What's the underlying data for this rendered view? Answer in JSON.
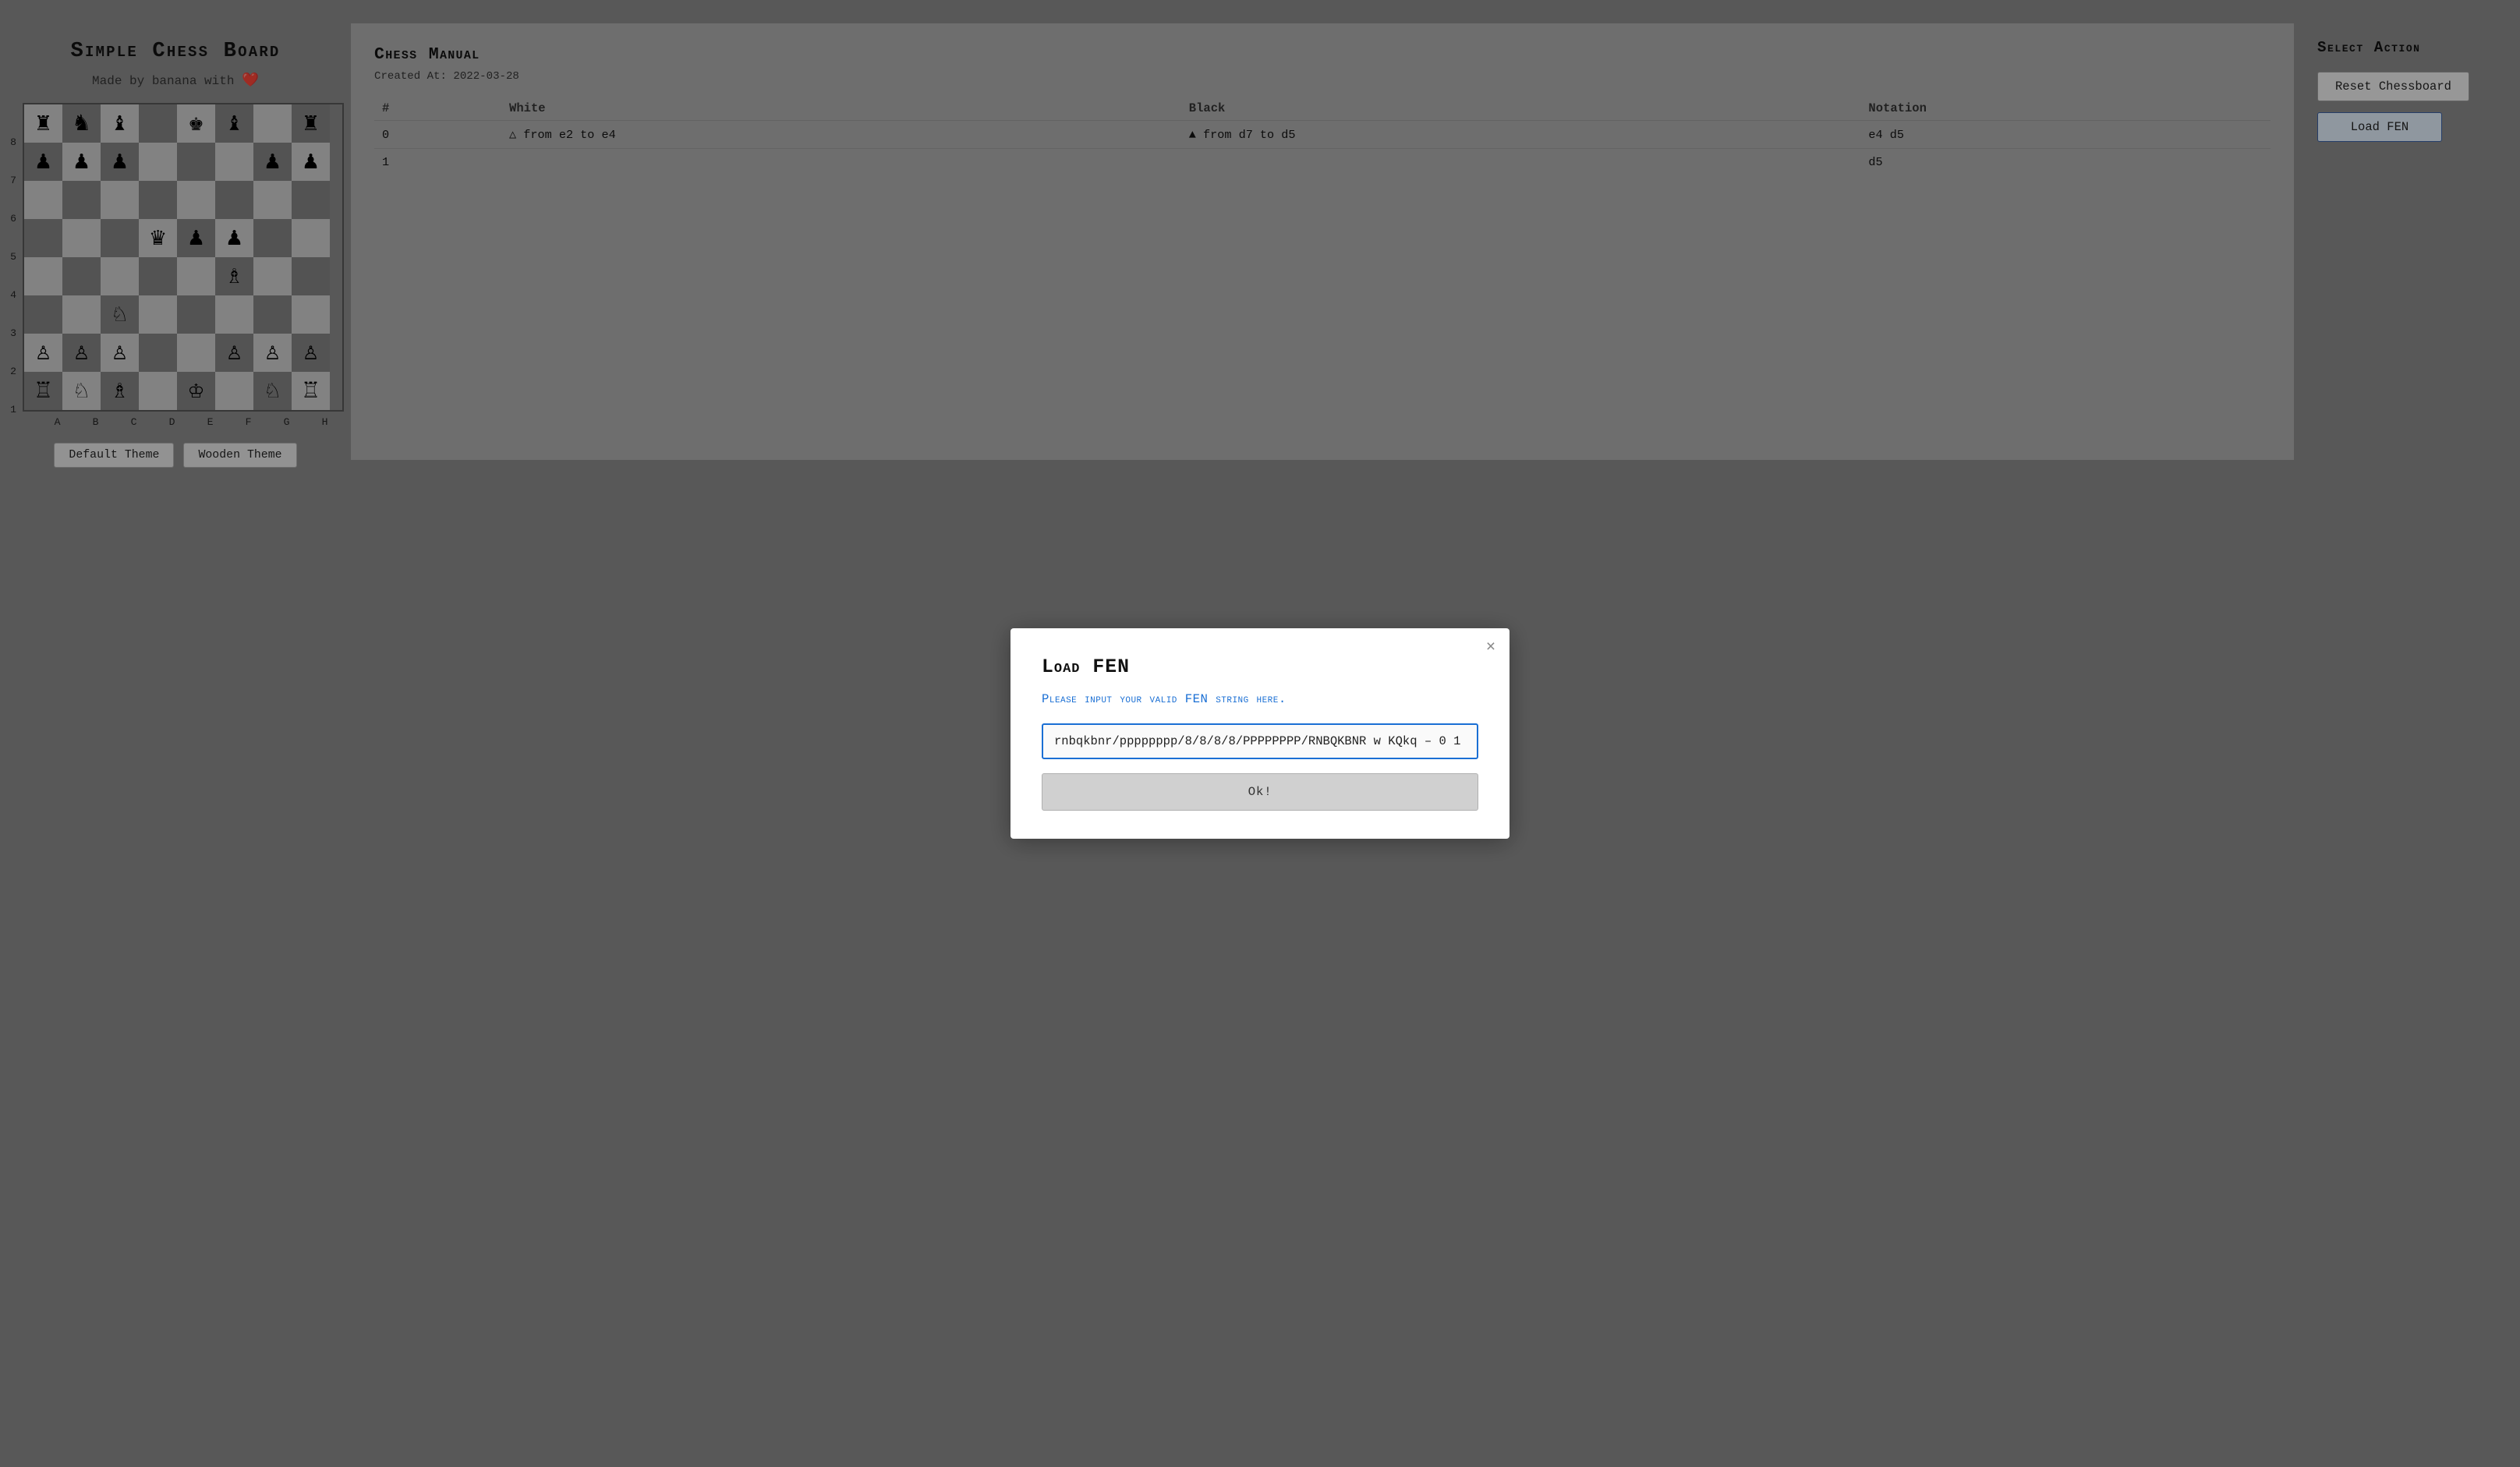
{
  "app": {
    "title": "Simple Chess Board",
    "subtitle_prefix": "Made by banana with",
    "heart": "❤️"
  },
  "board": {
    "ranks": [
      "8",
      "7",
      "6",
      "5",
      "4",
      "3",
      "2",
      "1"
    ],
    "files": [
      "a",
      "b",
      "c",
      "d",
      "e",
      "f",
      "g",
      "h"
    ],
    "files_lower": [
      "A",
      "B",
      "C",
      "D",
      "E",
      "F",
      "G",
      "H"
    ],
    "pieces": [
      [
        "♜",
        "♞",
        "♝",
        "",
        "♚",
        "♝",
        "",
        "♜"
      ],
      [
        "♟",
        "♟",
        "♟",
        "",
        "",
        "",
        "♟",
        "♟"
      ],
      [
        "",
        "",
        "",
        "",
        "",
        "",
        "",
        ""
      ],
      [
        "",
        "",
        "",
        "♛",
        "♟",
        "♟",
        "",
        ""
      ],
      [
        "",
        "",
        "",
        "",
        "",
        "♗",
        "",
        ""
      ],
      [
        "",
        "",
        "♘",
        "",
        "",
        "",
        "",
        ""
      ],
      [
        "♙",
        "♙",
        "♙",
        "",
        "",
        "♙",
        "♙",
        "♙"
      ],
      [
        "♖",
        "♘",
        "♗",
        "",
        "♔",
        "",
        "♘",
        "♖"
      ]
    ]
  },
  "themes": {
    "default_label": "Default Theme",
    "wooden_label": "Wooden Theme"
  },
  "manual": {
    "title": "Chess Manual",
    "created_label": "Created At: 2022-03-28",
    "columns": [
      "#",
      "White",
      "Black",
      "Notation"
    ],
    "moves": [
      {
        "num": "0",
        "white": "△ from e2 to e4",
        "black": "▲ from d7 to d5",
        "notation": "e4 d5"
      },
      {
        "num": "1",
        "white": "",
        "black": "",
        "notation": "d5"
      }
    ]
  },
  "actions": {
    "title": "Select Action",
    "reset_label": "Reset Chessboard",
    "load_fen_label": "Load FEN"
  },
  "modal": {
    "title": "Load FEN",
    "subtitle": "Please input your valid FEN string here.",
    "input_value": "rnbqkbnr/pppppppp/8/8/8/8/PPPPPPPP/RNBQKBNR w KQkq – 0 1",
    "input_placeholder": "rnbqkbnr/pppppppp/8/8/8/8/PPPPPPPP/RNBQKBNR w KQkq – 0 1",
    "ok_label": "Ok!",
    "close_label": "×"
  }
}
